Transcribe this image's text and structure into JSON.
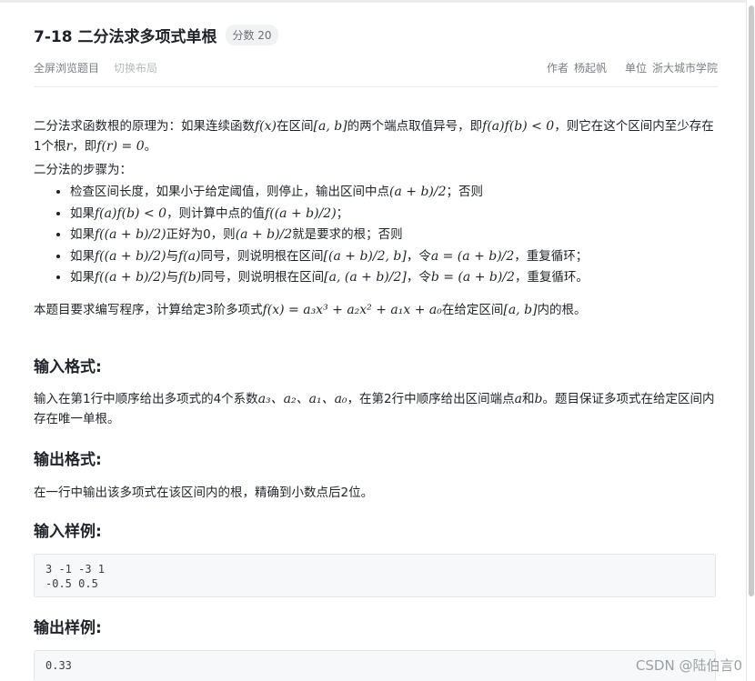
{
  "problem": {
    "title": "7-18 二分法求多项式单根",
    "score_label": "分数 20"
  },
  "toolbar": {
    "fullscreen_label": "全屏浏览题目",
    "switch_layout_label": "切换布局"
  },
  "meta": {
    "author_label": "作者",
    "author_value": "杨起帆",
    "unit_label": "单位",
    "unit_value": "浙大城市学院"
  },
  "description": {
    "para1_a": "二分法求函数根的原理为：如果连续函数",
    "para1_m1": "f(x)",
    "para1_b": "在区间",
    "para1_m2": "[a, b]",
    "para1_c": "的两个端点取值异号，即",
    "para1_m3": "f(a)f(b) < 0",
    "para1_d": "，则它在这个区间内至少存在1个根",
    "para1_m4": "r",
    "para1_e": "，即",
    "para1_m5": "f(r) = 0",
    "para1_f": "。",
    "para2": "二分法的步骤为：",
    "steps": [
      {
        "t1": "检查区间长度，如果小于给定阈值，则停止，输出区间中点",
        "m1": "(a + b)/2",
        "t2": "；否则"
      },
      {
        "t1": "如果",
        "m1": "f(a)f(b) < 0",
        "t2": "，则计算中点的值",
        "m2": "f((a + b)/2)",
        "t3": "；"
      },
      {
        "t1": "如果",
        "m1": "f((a + b)/2)",
        "t2": "正好为0，则",
        "m2": "(a + b)/2",
        "t3": "就是要求的根；否则"
      },
      {
        "t1": "如果",
        "m1": "f((a + b)/2)",
        "t2": "与",
        "m2": "f(a)",
        "t3": "同号，则说明根在区间",
        "m3": "[(a + b)/2, b]",
        "t4": "，令",
        "m4": "a = (a + b)/2",
        "t5": "，重复循环；"
      },
      {
        "t1": "如果",
        "m1": "f((a + b)/2)",
        "t2": "与",
        "m2": "f(b)",
        "t3": "同号，则说明根在区间",
        "m3": "[a, (a + b)/2]",
        "t4": "，令",
        "m4": "b = (a + b)/2",
        "t5": "，重复循环。"
      }
    ],
    "para3_a": "本题目要求编写程序，计算给定3阶多项式",
    "para3_m1": "f(x) = a₃x³ + a₂x² + a₁x + a₀",
    "para3_b": "在给定区间",
    "para3_m2": "[a, b]",
    "para3_c": "内的根。"
  },
  "input_format": {
    "heading": "输入格式:",
    "text_a": "输入在第1行中顺序给出多项式的4个系数",
    "text_m1": "a₃、a₂、a₁、a₀",
    "text_b": "，在第2行中顺序给出区间端点",
    "text_m2": "a",
    "text_c": "和",
    "text_m3": "b",
    "text_d": "。题目保证多项式在给定区间内存在唯一单根。"
  },
  "output_format": {
    "heading": "输出格式:",
    "text": "在一行中输出该多项式在该区间内的根，精确到小数点后2位。"
  },
  "sample_input": {
    "heading": "输入样例:",
    "lines": [
      "3 -1 -3 1",
      "-0.5 0.5"
    ]
  },
  "sample_output": {
    "heading": "输出样例:",
    "lines": [
      "0.33"
    ]
  },
  "watermark": "CSDN @陆伯言0"
}
